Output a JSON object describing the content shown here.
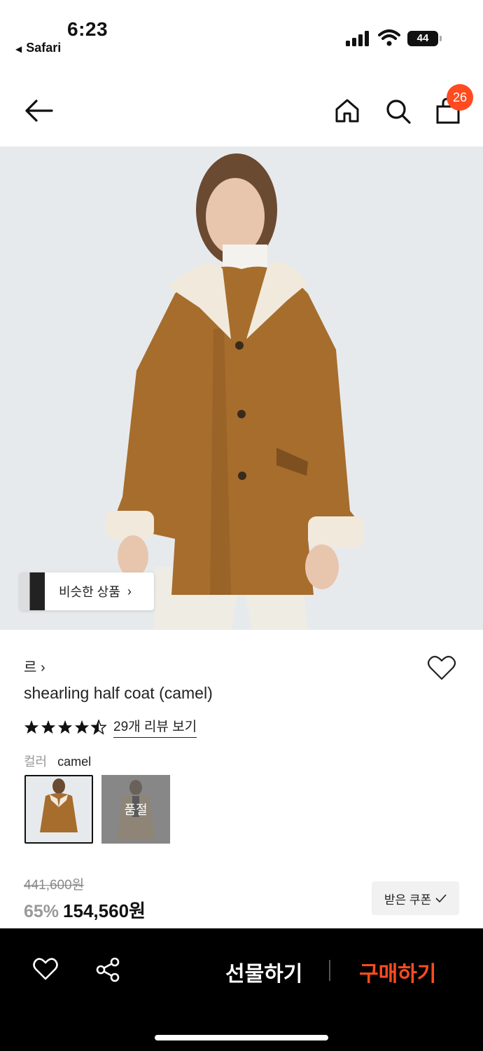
{
  "status": {
    "time": "6:23",
    "back_app": "Safari",
    "battery": "44"
  },
  "header": {
    "cart_count": "26"
  },
  "hero": {
    "similar_label": "비슷한 상품"
  },
  "product": {
    "brand": "르",
    "name": "shearling half coat (camel)",
    "rating": 4.5,
    "reviews_label": "29개 리뷰 보기",
    "color_key": "컬러",
    "color_value": "camel",
    "soldout_label": "품절",
    "original_price": "441,600원",
    "discount": "65%",
    "final_price": "154,560원",
    "coupon_label": "받은 쿠폰"
  },
  "bottom": {
    "gift_label": "선물하기",
    "buy_label": "구매하기"
  },
  "colors": {
    "accent": "#ff4b1f",
    "bar": "#000000"
  }
}
